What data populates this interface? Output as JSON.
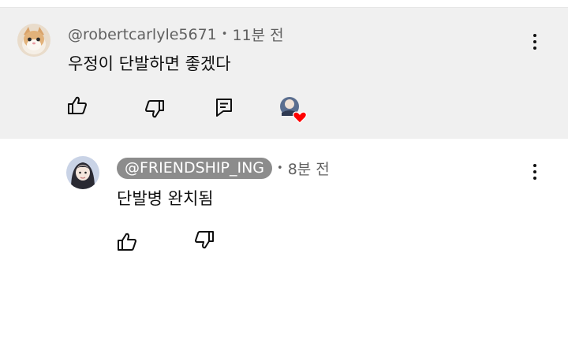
{
  "comments": [
    {
      "handle": "@robertcarlyle5671",
      "time": "11분 전",
      "text": "우정이 단발하면 좋겠다",
      "actions": [
        "like",
        "dislike",
        "reply",
        "creator-heart"
      ]
    }
  ],
  "reply": {
    "handle": "@FRIENDSHIP_ING",
    "time": "8분 전",
    "text": "단발병 완치됨",
    "actions": [
      "like",
      "dislike"
    ]
  },
  "separator": "•",
  "colors": {
    "main_bg": "#f0f0f0",
    "pill_bg": "#8c8c8c",
    "heart": "#ff0000"
  }
}
